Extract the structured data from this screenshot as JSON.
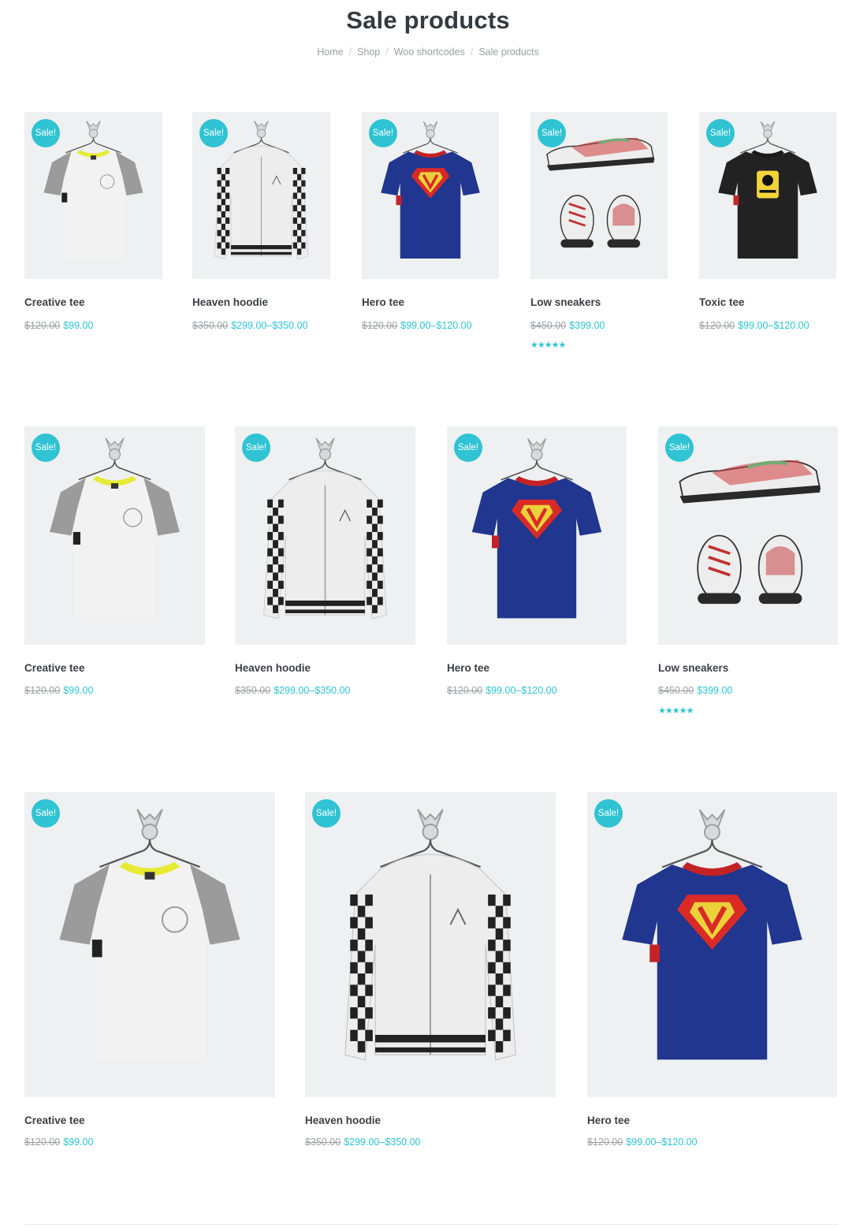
{
  "page": {
    "title": "Sale products",
    "breadcrumb": [
      {
        "label": "Home"
      },
      {
        "label": "Shop"
      },
      {
        "label": "Woo shortcodes"
      },
      {
        "label": "Sale products"
      }
    ]
  },
  "badge_label": "Sale!",
  "accent_color": "#2fc3d3",
  "products": {
    "creative": {
      "name": "Creative tee",
      "old": "$120.00",
      "now": "$99.00",
      "image": "white-tee-gray-sleeves-icon"
    },
    "hoodie": {
      "name": "Heaven hoodie",
      "old": "$350.00",
      "now": "$299.00–$350.00",
      "image": "white-hoodie-checkered-sleeves-icon"
    },
    "hero": {
      "name": "Hero tee",
      "old": "$120.00",
      "now": "$99.00–$120.00",
      "image": "blue-hero-tee-icon"
    },
    "sneakers": {
      "name": "Low sneakers",
      "old": "$450.00",
      "now": "$399.00",
      "rating": 5,
      "image": "sneakers-icon"
    },
    "toxic": {
      "name": "Toxic tee",
      "old": "$120.00",
      "now": "$99.00–$120.00",
      "image": "black-poison-tee-icon"
    }
  },
  "rows": [
    [
      "creative",
      "hoodie",
      "hero",
      "sneakers",
      "toxic"
    ],
    [
      "creative",
      "hoodie",
      "hero",
      "sneakers"
    ],
    [
      "creative",
      "hoodie",
      "hero"
    ]
  ]
}
